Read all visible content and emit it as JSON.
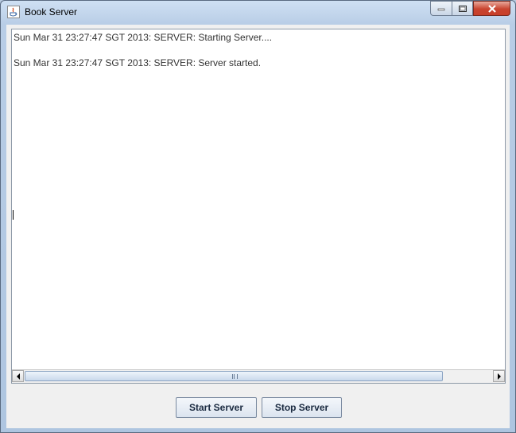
{
  "window": {
    "title": "Book Server",
    "controls": {
      "minimize": "minimize-icon",
      "maximize": "maximize-icon",
      "close": "close-icon"
    }
  },
  "log": {
    "lines": [
      "Sun Mar 31 23:27:47 SGT 2013: SERVER: Starting Server....",
      "Sun Mar 31 23:27:47 SGT 2013: SERVER: Server started."
    ]
  },
  "buttons": {
    "start_label": "Start Server",
    "stop_label": "Stop Server"
  },
  "colors": {
    "accent": "#b8cde6",
    "close_button": "#c7402a"
  }
}
